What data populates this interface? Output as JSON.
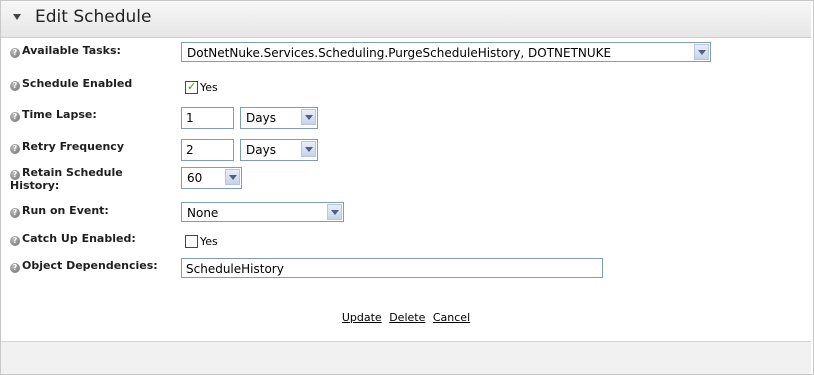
{
  "header": {
    "title": "Edit Schedule"
  },
  "form": {
    "available_tasks": {
      "label": "Available Tasks:",
      "value": "DotNetNuke.Services.Scheduling.PurgeScheduleHistory, DOTNETNUKE"
    },
    "schedule_enabled": {
      "label": "Schedule Enabled",
      "checked": true,
      "checkbox_label": "Yes"
    },
    "time_lapse": {
      "label": "Time Lapse:",
      "value": "1",
      "unit": "Days"
    },
    "retry_frequency": {
      "label": "Retry Frequency",
      "value": "2",
      "unit": "Days"
    },
    "retain_history": {
      "label_line1": "Retain Schedule",
      "label_line2": "History:",
      "value": "60"
    },
    "run_on_event": {
      "label": "Run on Event:",
      "value": "None"
    },
    "catch_up_enabled": {
      "label": "Catch Up Enabled:",
      "checked": false,
      "checkbox_label": "Yes"
    },
    "object_dependencies": {
      "label": "Object Dependencies:",
      "value": "ScheduleHistory"
    }
  },
  "actions": {
    "update": "Update",
    "delete": "Delete",
    "cancel": "Cancel"
  },
  "icons": {
    "help": "help-icon",
    "dropdown": "chevron-down-icon",
    "check": "check-icon",
    "collapse": "collapse-arrow-icon"
  }
}
